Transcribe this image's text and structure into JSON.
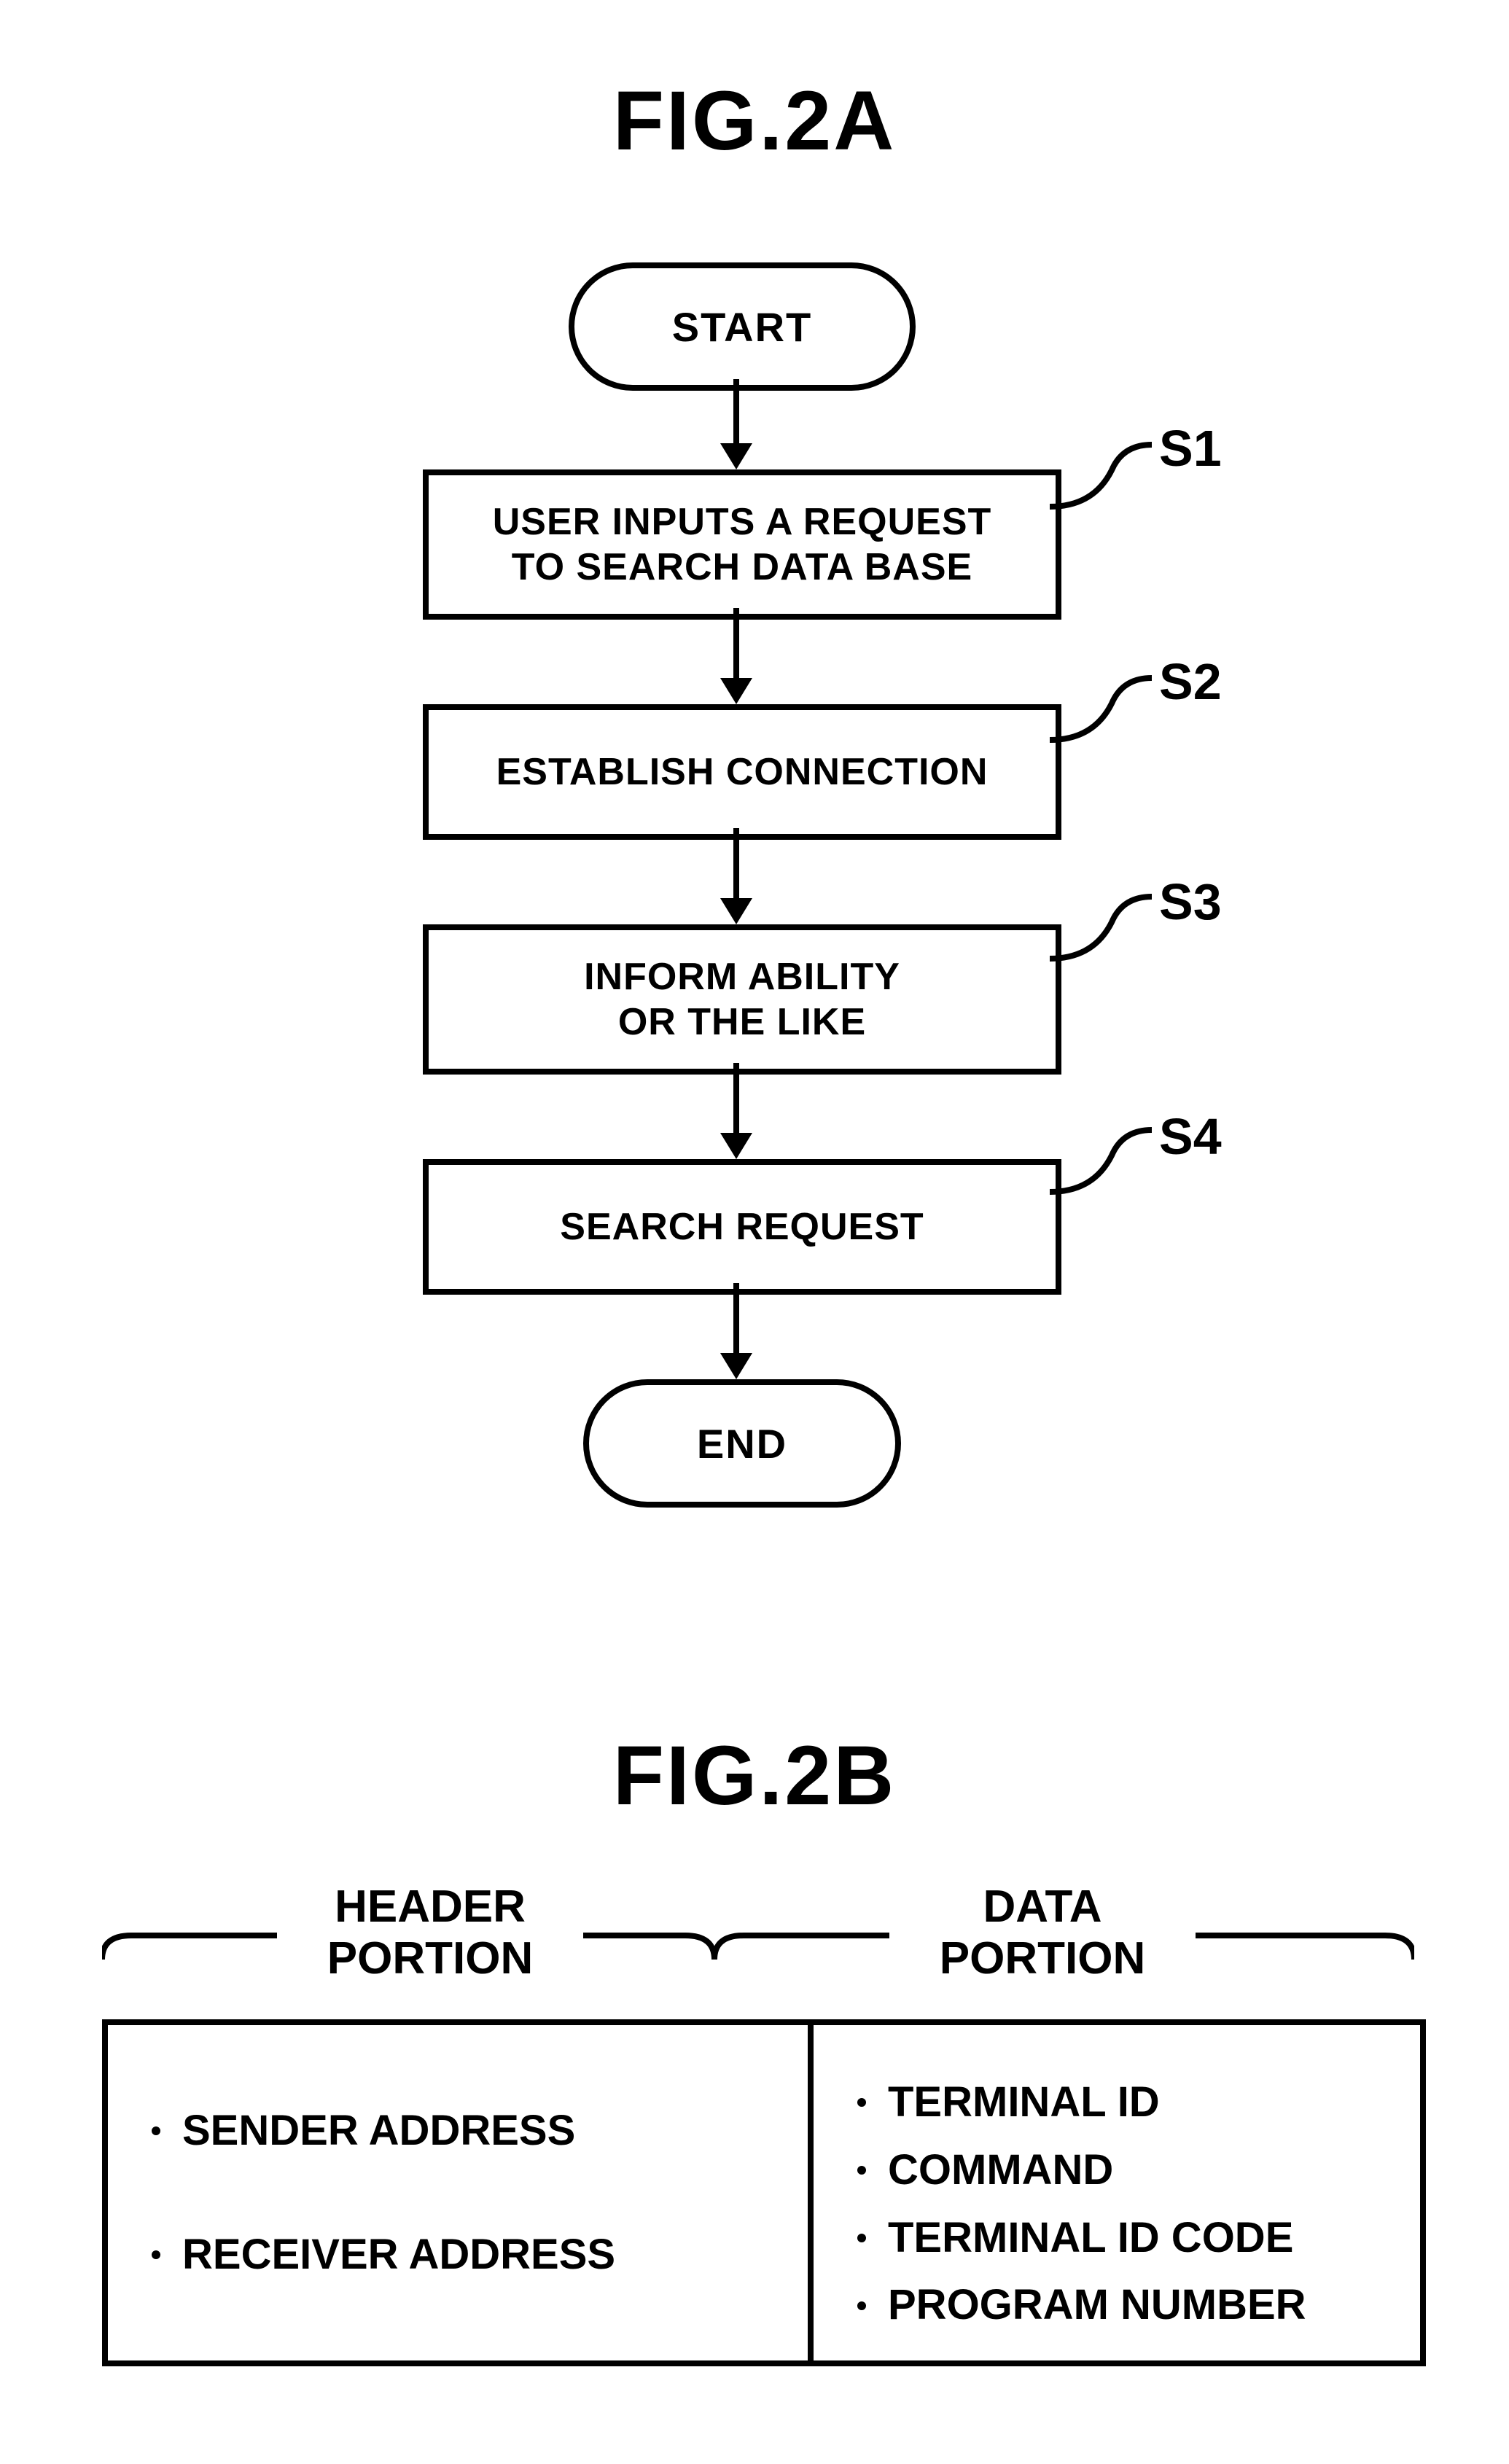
{
  "figA": {
    "title": "FIG.2A",
    "start": "START",
    "end": "END",
    "steps": [
      {
        "label": "S1",
        "text1": "USER INPUTS A REQUEST",
        "text2": "TO SEARCH DATA BASE"
      },
      {
        "label": "S2",
        "text1": "ESTABLISH CONNECTION",
        "text2": ""
      },
      {
        "label": "S3",
        "text1": "INFORM ABILITY",
        "text2": "OR THE LIKE"
      },
      {
        "label": "S4",
        "text1": "SEARCH REQUEST",
        "text2": ""
      }
    ]
  },
  "figB": {
    "title": "FIG.2B",
    "headerPortion": {
      "label1": "HEADER",
      "label2": "PORTION",
      "items": [
        "SENDER ADDRESS",
        "RECEIVER ADDRESS"
      ]
    },
    "dataPortion": {
      "label1": "DATA",
      "label2": "PORTION",
      "items": [
        "TERMINAL ID",
        "COMMAND",
        "TERMINAL ID CODE",
        "PROGRAM NUMBER"
      ]
    }
  }
}
